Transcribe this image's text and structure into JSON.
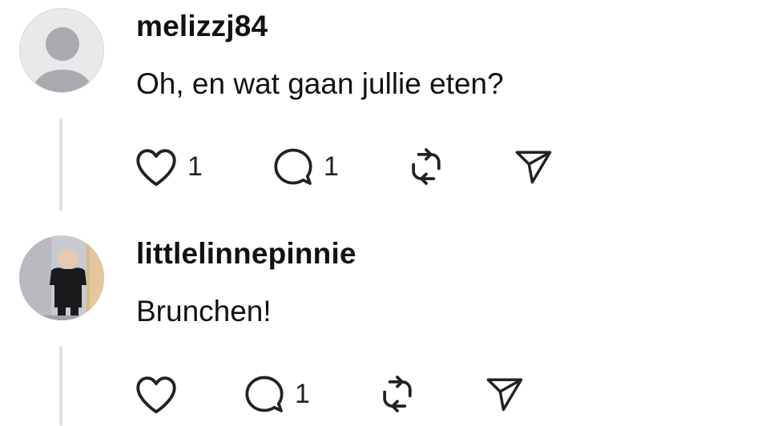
{
  "replies": [
    {
      "username": "melizzj84",
      "text": "Oh, en wat gaan jullie eten?",
      "avatar": "default-avatar",
      "likes": "1",
      "comments": "1"
    },
    {
      "username": "littlelinnepinnie",
      "text": "Brunchen!",
      "avatar": "photo-avatar",
      "likes": "",
      "comments": "1"
    }
  ],
  "icons": {
    "like": "heart-icon",
    "comment": "comment-icon",
    "repost": "repost-icon",
    "share": "send-icon"
  },
  "colors": {
    "text": "#111111",
    "thread_line": "#e2e2e4",
    "default_avatar_bg": "#e9e9eb",
    "default_avatar_fg": "#a9a9ae"
  }
}
